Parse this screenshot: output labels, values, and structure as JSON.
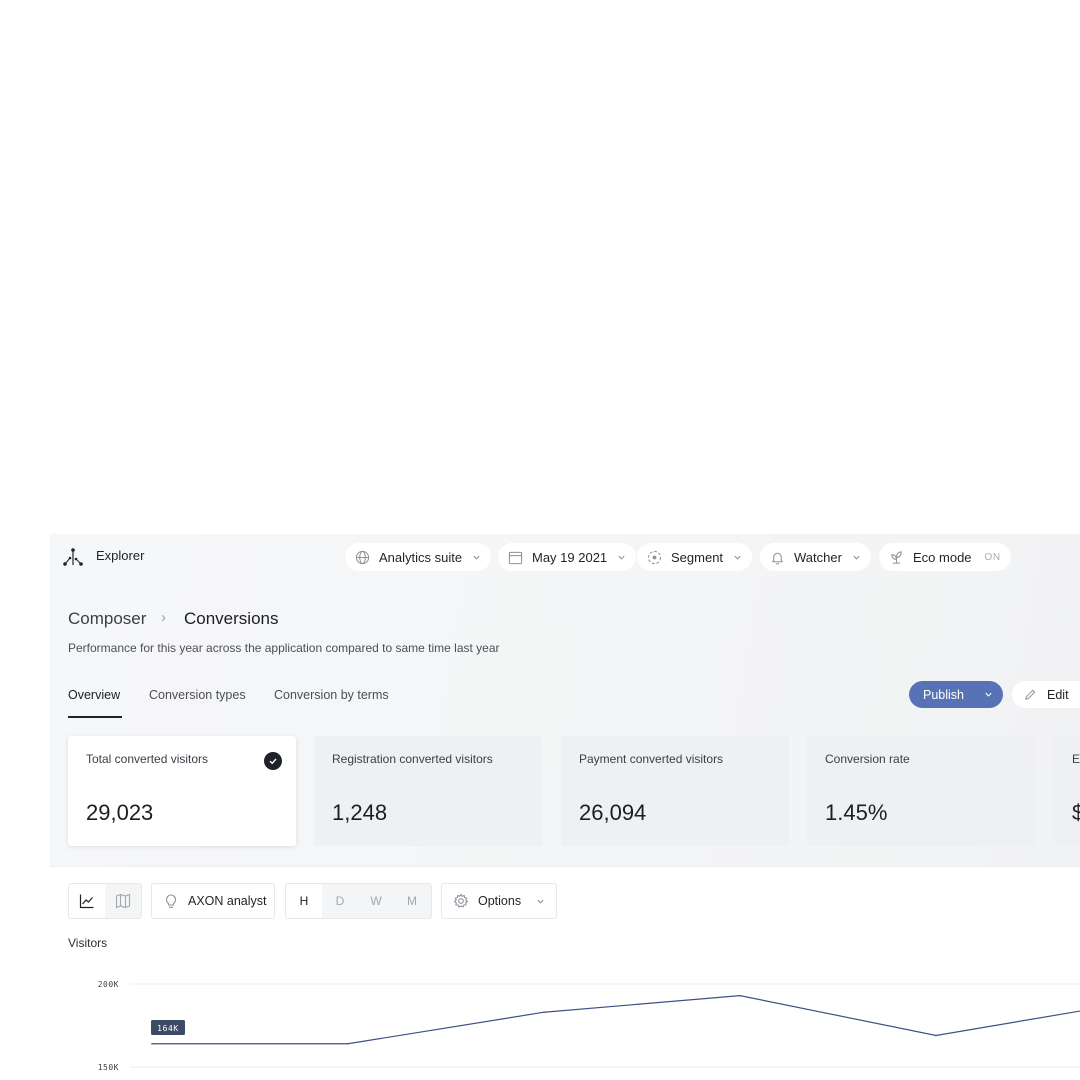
{
  "topbar": {
    "app_name": "Explorer",
    "pills": {
      "suite": {
        "label": "Analytics suite",
        "icon": "globe-icon"
      },
      "date": {
        "label": "May 19 2021",
        "icon": "calendar-icon"
      },
      "segment": {
        "label": "Segment",
        "icon": "segment-icon"
      },
      "watcher": {
        "label": "Watcher",
        "icon": "bell-icon"
      },
      "eco": {
        "label": "Eco mode",
        "status": "ON",
        "icon": "leaf-icon"
      }
    }
  },
  "breadcrumb": {
    "parent": "Composer",
    "separator": "›",
    "current": "Conversions"
  },
  "subtitle": "Performance for this year across the application compared to same time last year",
  "tabs": [
    {
      "label": "Overview",
      "active": true
    },
    {
      "label": "Conversion types"
    },
    {
      "label": "Conversion by terms"
    }
  ],
  "actions": {
    "publish": "Publish",
    "edit": "Edit"
  },
  "metrics": [
    {
      "label": "Total converted visitors",
      "value": "29,023",
      "selected": true
    },
    {
      "label": "Registration converted visitors",
      "value": "1,248"
    },
    {
      "label": "Payment converted visitors",
      "value": "26,094"
    },
    {
      "label": "Conversion rate",
      "value": "1.45%"
    },
    {
      "label": "E",
      "value": "$"
    }
  ],
  "toolbar": {
    "view_modes": [
      "line-chart-icon",
      "map-icon"
    ],
    "analyst": {
      "label": "AXON analyst",
      "icon": "lightbulb-icon"
    },
    "granularity": [
      "H",
      "D",
      "W",
      "M"
    ],
    "granularity_selected": "H",
    "options": {
      "label": "Options",
      "icon": "gear-icon"
    }
  },
  "colors": {
    "accent": "#5873b5",
    "line": "#3d5186",
    "tag_bg": "#3d4b66"
  },
  "chart_data": {
    "type": "line",
    "title": "Visitors",
    "ytick_labels": [
      "200K",
      "150K"
    ],
    "ylim": [
      150000,
      200000
    ],
    "tooltip_label": "164K",
    "series": [
      {
        "values": [
          164000,
          164000,
          183000,
          193000,
          169000,
          189000
        ]
      }
    ]
  }
}
